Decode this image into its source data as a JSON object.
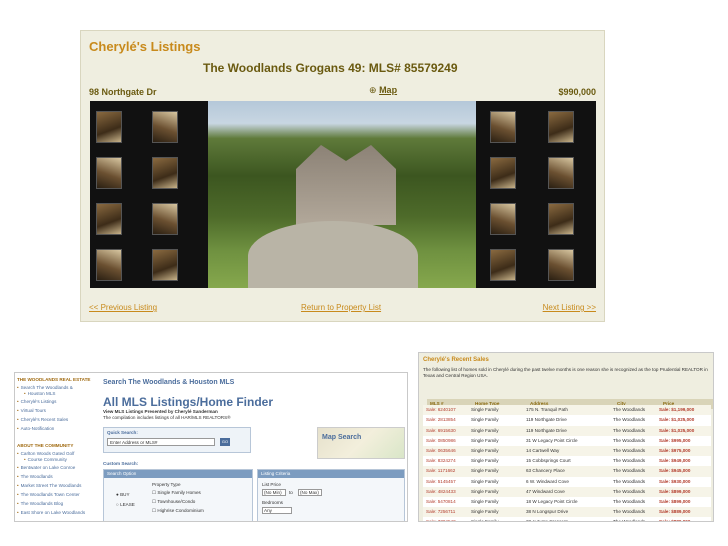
{
  "listing": {
    "site_title": "Cherylé's Listings",
    "listing_title": "The Woodlands Grogans 49: MLS# 85579249",
    "address": "98 Northgate Dr",
    "map_label": "Map",
    "price": "$990,000",
    "prev_label": "<< Previous Listing",
    "return_label": "Return to Property List",
    "next_label": "Next Listing >>"
  },
  "sidebar": {
    "heading1": "THE WOODLANDS REAL ESTATE",
    "items1": [
      "Search The Woodlands &",
      "Houston MLS",
      "Cherylé's Listings",
      "Virtual Tours",
      "Cherylé's Recent Sales",
      "Auto-Notification"
    ],
    "heading2": "ABOUT THE COMMUNITY",
    "items2": [
      "Carlton Woods Gated Golf",
      "Course Community",
      "Bentwater on Lake Conroe",
      "The Woodlands",
      "Market Street The Woodlands",
      "The Woodlands Town Center",
      "The Woodlands Blog",
      "East Shore on Lake Woodlands"
    ]
  },
  "mls": {
    "header": "Search The Woodlands & Houston MLS",
    "title": "All MLS Listings/Home Finder",
    "subtitle": "View MLS Listings Presented by Cherylé Sanderman",
    "note": "The compilation includes listings of all HAR/MLS REALTORS®",
    "quick_label": "Quick Search:",
    "quick_placeholder": "Enter Address or MLS#",
    "go_label": "GO",
    "map_search": "Map Search",
    "custom_label": "Custom Search:",
    "search_option": "Search Option",
    "listing_criteria": "Listing Criteria",
    "property_type": "Property Type",
    "buy": "BUY",
    "lease": "LEASE",
    "types": [
      "Single Family Homes",
      "Townhouse/Condo",
      "Highrise Condominium"
    ],
    "list_price": "List Price",
    "no_min": "(No Min)",
    "to": "to",
    "no_max": "(No Max)",
    "bedrooms": "Bedrooms",
    "any": "Any"
  },
  "sales": {
    "title": "Cherylé's Recent Sales",
    "description": "The following list of homes sold in Cherylé during the past twelve months is one reason she is recognized as the top Prudential REALTOR in Texas and Central Region USA.",
    "columns": [
      "MLS #",
      "Home Type",
      "Address",
      "City",
      "Price"
    ],
    "rows": [
      [
        "Sale: 6240107",
        "Single Family",
        "175 N. Tranquil Path",
        "The Woodlands",
        "Sale: $1,199,000"
      ],
      [
        "Sale: 2813854",
        "Single Family",
        "119 Northgate Drive",
        "The Woodlands",
        "Sale: $1,025,000"
      ],
      [
        "Sale: 6915630",
        "Single Family",
        "119 Northgate Drive",
        "The Woodlands",
        "Sale: $1,025,000"
      ],
      [
        "Sale: 0850986",
        "Single Family",
        "31 W Legacy Point Circle",
        "The Woodlands",
        "Sale: $995,000"
      ],
      [
        "Sale: 0635646",
        "Single Family",
        "14 Cartwell Way",
        "The Woodlands",
        "Sale: $975,000"
      ],
      [
        "Sale: 8324274",
        "Single Family",
        "15 Cobbsprings Court",
        "The Woodlands",
        "Sale: $949,000"
      ],
      [
        "Sale: 1171662",
        "Single Family",
        "63 Chancery Place",
        "The Woodlands",
        "Sale: $945,000"
      ],
      [
        "Sale: 5145457",
        "Single Family",
        "6 W. Windward Cove",
        "The Woodlands",
        "Sale: $930,000"
      ],
      [
        "Sale: 4824433",
        "Single Family",
        "47 Windward Cove",
        "The Woodlands",
        "Sale: $899,000"
      ],
      [
        "Sale: 5470814",
        "Single Family",
        "18 W Legacy Point Circle",
        "The Woodlands",
        "Sale: $899,000"
      ],
      [
        "Sale: 7256711",
        "Single Family",
        "38 N Longspur Drive",
        "The Woodlands",
        "Sale: $889,000"
      ],
      [
        "Sale: 3704540",
        "Single Family",
        "28 Autumn Crescent",
        "The Woodlands",
        "Sale: $889,000"
      ],
      [
        "Sale: 3420393",
        "Single Family",
        "19 S. Pevensey Circle",
        "The Woodlands",
        "Sale: $869,000"
      ]
    ]
  },
  "colors": {
    "gold": "#c88a1c",
    "blue": "#4b6d9c",
    "panel": "#efeee0"
  }
}
